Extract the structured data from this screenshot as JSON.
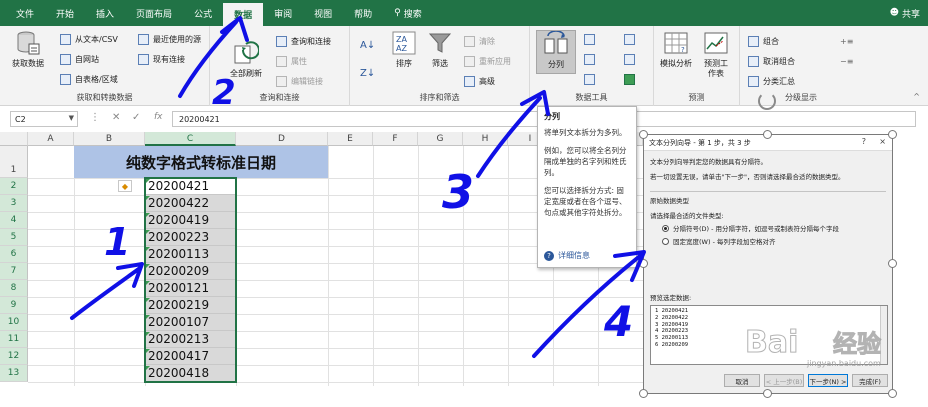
{
  "ribbon_tabs": [
    {
      "label": "文件"
    },
    {
      "label": "开始"
    },
    {
      "label": "插入"
    },
    {
      "label": "页面布局"
    },
    {
      "label": "公式"
    },
    {
      "label": "数据",
      "active": true
    },
    {
      "label": "审阅"
    },
    {
      "label": "视图"
    },
    {
      "label": "帮助"
    },
    {
      "label": "搜索",
      "icon": "search-icon"
    }
  ],
  "share": {
    "label": "共享",
    "icon": "person-icon"
  },
  "groups": {
    "get_transform": {
      "label": "获取和转换数据",
      "big_button": "获取数据",
      "items": [
        "从文本/CSV",
        "自网站",
        "自表格/区域",
        "最近使用的源",
        "现有连接"
      ]
    },
    "queries": {
      "label": "查询和连接",
      "big_button": "全部刷新",
      "items": [
        "查询和连接",
        "属性",
        "编辑链接"
      ]
    },
    "sort_filter": {
      "label": "排序和筛选",
      "sort": "排序",
      "filter": "筛选",
      "items": [
        "清除",
        "重新应用",
        "高级"
      ]
    },
    "data_tools": {
      "label": "数据工具",
      "split_button": "分列"
    },
    "forecast": {
      "label": "预测",
      "whatif": "模拟分析",
      "sheet": "预测工作表"
    },
    "outline": {
      "label": "分级显示",
      "items": [
        "组合",
        "取消组合",
        "分类汇总"
      ]
    }
  },
  "formula_bar": {
    "name_box": "C2",
    "fx": "fx",
    "value": "20200421"
  },
  "columns": [
    "A",
    "B",
    "C",
    "D",
    "E",
    "F",
    "G",
    "H",
    "I",
    "J",
    "K"
  ],
  "rows": [
    "1",
    "2",
    "3",
    "4",
    "5",
    "6",
    "7",
    "8",
    "9",
    "10",
    "11",
    "12",
    "13"
  ],
  "sheet": {
    "title": "纯数字格式转标准日期",
    "values": [
      "20200421",
      "20200422",
      "20200419",
      "20200223",
      "20200113",
      "20200209",
      "20200121",
      "20200219",
      "20200107",
      "20200213",
      "20200417",
      "20200418"
    ]
  },
  "tooltip": {
    "title": "分列",
    "p1": "将单列文本拆分为多列。",
    "p2": "例如，您可以将全名列分隔成单独的名字列和姓氏列。",
    "p3": "您可以选择拆分方式: 固定宽度或者在各个逗号、句点或其他字符处拆分。",
    "link": "详细信息"
  },
  "dialog": {
    "title": "文本分列向导 - 第 1 步，共 3 步",
    "help": "?",
    "close": "×",
    "line1": "文本分列向导判定您的数据具有分隔符。",
    "line2": "若一切设置无误，请单击\"下一步\"，否则请选择最合适的数据类型。",
    "section": "原始数据类型",
    "section_hint": "请选择最合适的文件类型:",
    "radio1": "分隔符号(D) - 用分隔字符，如逗号或制表符分隔每个字段",
    "radio2": "固定宽度(W) - 每列字段加空格对齐",
    "preview_label": "预览选定数据:",
    "preview_rows": [
      "1 20200421",
      "2 20200422",
      "3 20200419",
      "4 20200223",
      "5 20200113",
      "6 20200209"
    ],
    "buttons": {
      "cancel": "取消",
      "back": "< 上一步(B)",
      "next": "下一步(N) >",
      "finish": "完成(F)"
    }
  },
  "annotations": {
    "n1": "1",
    "n2": "2",
    "n3": "3",
    "n4": "4"
  },
  "watermark": {
    "text": "Bai",
    "text2": "经验",
    "sub": "jingyan.baidu.com"
  },
  "colors": {
    "excel_green": "#217346",
    "title_fill": "#aec3e6",
    "ink": "#1010e6",
    "selection": "#d9d9d9"
  }
}
